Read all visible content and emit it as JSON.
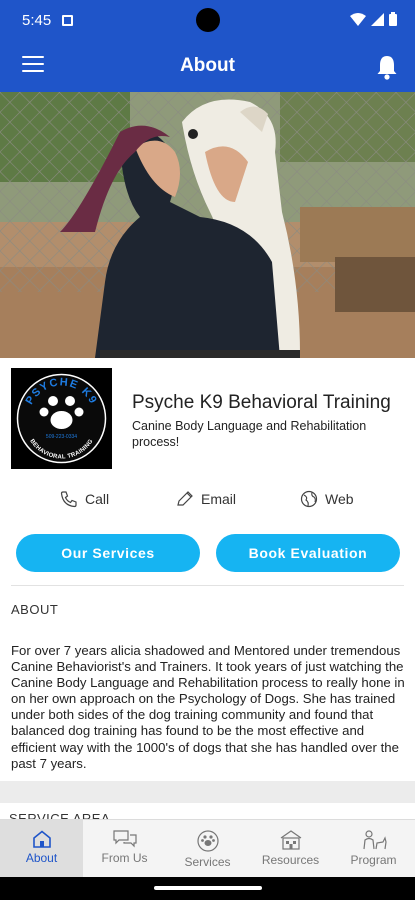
{
  "status_bar": {
    "time": "5:45"
  },
  "app_bar": {
    "title": "About"
  },
  "business": {
    "name": "Psyche K9 Behavioral Training",
    "description": "Canine Body Language and Rehabilitation process!",
    "logo": {
      "top_text": "PSYCHE K9",
      "phone": "509-223-0334",
      "bottom_text": "BEHAVIORAL TRAINING"
    }
  },
  "contacts": {
    "call": "Call",
    "email": "Email",
    "web": "Web"
  },
  "buttons": {
    "services": "Our Services",
    "evaluation": "Book Evaluation"
  },
  "about": {
    "heading": "ABOUT",
    "body": "For over 7 years alicia shadowed and Mentored under tremendous Canine Behaviorist's and Trainers. It took years of just watching the Canine Body Language and Rehabilitation process to really hone in on her own approach on the Psychology of Dogs. She has trained under both sides of the dog training community and found that balanced dog training has found to be the most effective and efficient way with the 1000's of dogs that she has handled over the past 7 years."
  },
  "service_area": {
    "heading": "SERVICE AREA"
  },
  "tabs": [
    {
      "label": "About",
      "icon": "home-icon",
      "active": true
    },
    {
      "label": "From Us",
      "icon": "chat-icon",
      "active": false
    },
    {
      "label": "Services",
      "icon": "paw-badge-icon",
      "active": false
    },
    {
      "label": "Resources",
      "icon": "building-icon",
      "active": false
    },
    {
      "label": "Program",
      "icon": "trainer-icon",
      "active": false
    }
  ],
  "colors": {
    "primary": "#1f55c9",
    "accent": "#16b4f2"
  }
}
